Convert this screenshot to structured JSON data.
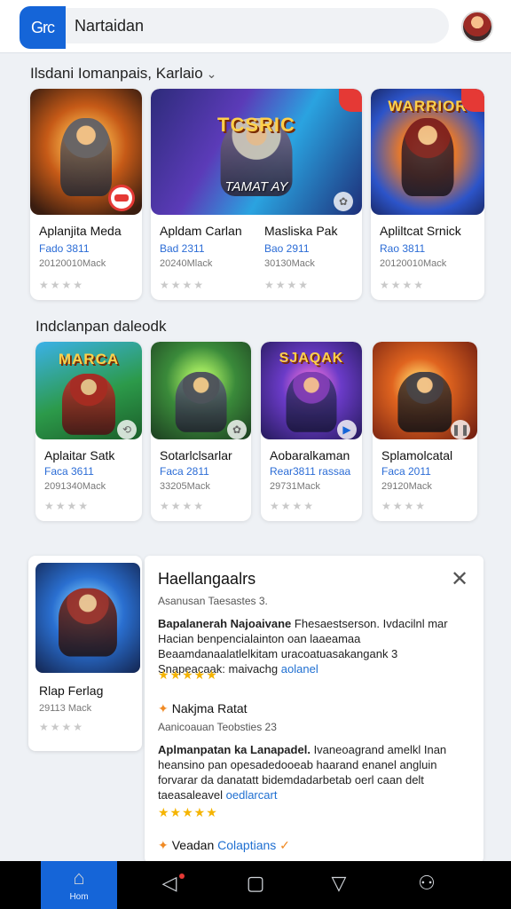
{
  "header": {
    "logo_text": "Grc",
    "search_value": "Nartaidan",
    "avatar_icon": "user-avatar-icon"
  },
  "section1": {
    "title": "Ilsdani Iomanpais, Karlaio",
    "cards": [
      {
        "name": "Aplanjita Meda",
        "meta": "Fado 3811",
        "size": "20120010Mack",
        "stars": "★★★★"
      },
      {
        "name": "Apldam Carlan",
        "meta": "Bad 2311",
        "size": "20240Mlack",
        "stars": "★★★★"
      },
      {
        "name": "Masliska Pak",
        "meta": "Bao 2911",
        "size": "30130Mack",
        "stars": "★★★★"
      },
      {
        "name": "Apliltcat Srnick",
        "meta": "Rao 3811",
        "size": "20120010Mack",
        "stars": "★★★★"
      }
    ],
    "wide_card_art": {
      "title": "TCSRIC",
      "subtitle": "TAMAT AY"
    },
    "card4_art": {
      "title": "WARRIOR"
    }
  },
  "section2": {
    "title": "Indclanpan daleodk",
    "cards": [
      {
        "name": "Aplaitar Satk",
        "meta": "Faca 3611",
        "size": "2091340Mack",
        "stars": "★★★★",
        "art_title": "MARCA"
      },
      {
        "name": "Sotarlclsarlar",
        "meta": "Faca 2811",
        "size": "33205Mack",
        "stars": "★★★★",
        "art_title": ""
      },
      {
        "name": "Aobaralkaman",
        "meta": "Rear3811 rassaa",
        "size": "29731Mack",
        "stars": "★★★★",
        "art_title": "SJAQAK"
      },
      {
        "name": "Splamolcatal",
        "meta": "Faca 2011",
        "size": "29120Mack",
        "stars": "★★★★",
        "art_title": ""
      }
    ]
  },
  "detail_card": {
    "name": "Rlap Ferlag",
    "size": "29113 Mack",
    "stars": "★★★★"
  },
  "panel": {
    "title": "Haellangaalrs",
    "close_icon": "close-icon",
    "sub1": "Asanusan Taesastes   3.",
    "review1": {
      "head": "Bapalanerah Najoaivane",
      "body": "Fhesaestserson. Ivdacilnl mar Hacian benpencialainton oan laaeamaa Beaamdanaalatlelkitam uracoatuasakangank 3 Snapeacaak: maivachg",
      "link": "aolanel",
      "stars": "★★★★★"
    },
    "sub2_head": "Nakjma Ratat",
    "sub2": "Aanicoauan Teobsties   23",
    "review2": {
      "head": "Aplmanpatan ka Lanapadel.",
      "body": "Ivaneoagrand amelkl Inan heansino pan opesadedooeab haarand enanel angluin forvarar da danatatt bidemdadarbetab oerl caan delt taeasaleavel",
      "link": "oedlarcart",
      "stars": "★★★★★"
    },
    "sub3_head": "Veadan",
    "sub3_link": "Colaptians"
  },
  "navbar": {
    "home_label": "Hom",
    "icons": [
      "home-icon",
      "back-icon",
      "recents-icon",
      "down-icon",
      "profile-icon"
    ]
  },
  "colors": {
    "accent": "#1565d8",
    "link": "#1f6fd1",
    "star": "#f5b400",
    "badge": "#e53935"
  }
}
